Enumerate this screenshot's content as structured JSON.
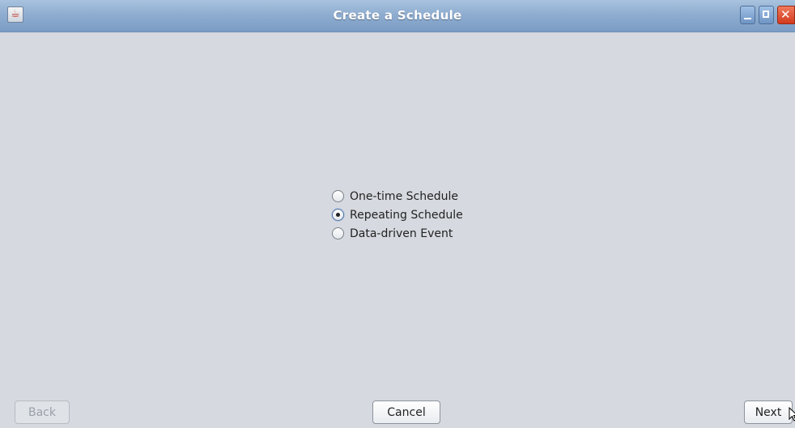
{
  "window": {
    "title": "Create a Schedule",
    "app_icon": "java-icon",
    "controls": [
      "minimize",
      "maximize",
      "close"
    ]
  },
  "schedule_type": {
    "options": [
      {
        "label": "One-time Schedule",
        "checked": false
      },
      {
        "label": "Repeating Schedule",
        "checked": true
      },
      {
        "label": "Data-driven Event",
        "checked": false
      }
    ]
  },
  "buttons": {
    "back": {
      "label": "Back",
      "enabled": false
    },
    "cancel": {
      "label": "Cancel",
      "enabled": true
    },
    "next": {
      "label": "Next",
      "enabled": true
    }
  }
}
